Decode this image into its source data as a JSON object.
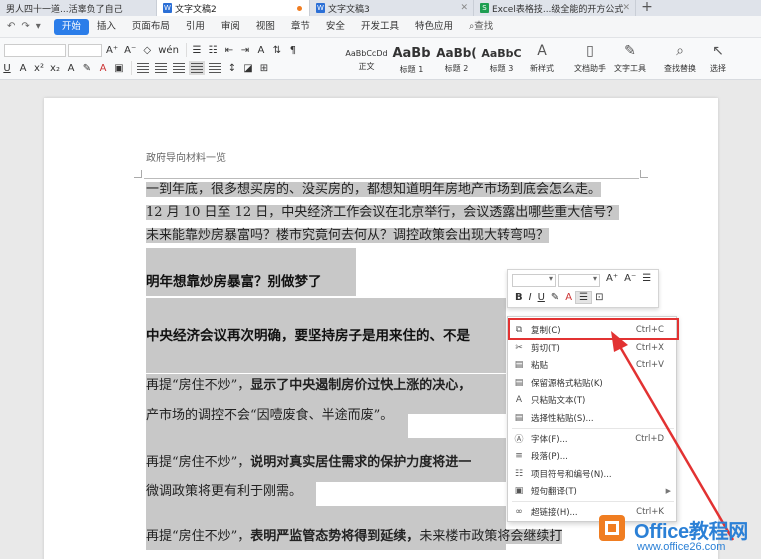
{
  "tabs": [
    {
      "label": "男人四十一道...活辜负了自己",
      "active": false
    },
    {
      "label": "文字文稿2",
      "active": true
    },
    {
      "label": "文字文稿3",
      "active": false
    },
    {
      "label": "Excel表格技...级全能的开方公式",
      "active": false
    }
  ],
  "tab_add": "+",
  "menu": {
    "start": "开始",
    "items": [
      "插入",
      "页面布局",
      "引用",
      "审阅",
      "视图",
      "章节",
      "安全",
      "开发工具",
      "特色应用"
    ],
    "search": "查找"
  },
  "ribbon": {
    "styles": [
      {
        "sample": "AaBbCcDd",
        "name": "正文"
      },
      {
        "sample": "AaBb",
        "name": "标题 1"
      },
      {
        "sample": "AaBb(",
        "name": "标题 2"
      },
      {
        "sample": "AaBbC",
        "name": "标题 3"
      }
    ],
    "big_buttons": [
      {
        "icon": "new-style-icon",
        "label": "新样式"
      },
      {
        "icon": "doc-helper-icon",
        "label": "文档助手"
      },
      {
        "icon": "text-tools-icon",
        "label": "文字工具"
      },
      {
        "icon": "find-replace-icon",
        "label": "查找替换"
      },
      {
        "icon": "select-icon",
        "label": "选择"
      }
    ]
  },
  "document": {
    "header_text": "政府导向材料一览",
    "para1": [
      "一到年底，很多想买房的、没买房的，都想知道明年房地产市场到底会怎么走。",
      "12 月 10 日至 12 日，中央经济工作会议在北京举行，会议透露出哪些重大信号？",
      "未来能靠炒房暴富吗？楼市究竟何去何从？调控政策会出现大转弯吗？"
    ],
    "heading1": "明年想靠炒房暴富？别做梦了",
    "heading2": "中央经济会议再次明确，要坚持房子是用来住的、不是",
    "p3a_prefix": "再提“房住不炒”，",
    "p3a_bold": "显示了中央遏制房价过快上涨的决心，",
    "p3b": "产市场的调控不会“因噎废食、半途而废”。",
    "p4a_prefix": "再提“房住不炒”，",
    "p4a_bold": "说明对真实居住需求的保护力度将进一",
    "p4b": "微调政策将更有利于刚需。",
    "p5a_prefix": "再提“房住不炒”，",
    "p5a_bold": "表明严监管态势将得到延续，",
    "p5a_tail": "未来楼市政策将会继续打"
  },
  "mini_toolbar": {
    "bold": "B",
    "italic": "I",
    "underline": "U",
    "font_grow": "A⁺",
    "font_shrink": "A⁻"
  },
  "context_menu": [
    {
      "icon": "copy-icon",
      "label": "复制(C)",
      "shortcut": "Ctrl+C"
    },
    {
      "icon": "cut-icon",
      "label": "剪切(T)",
      "shortcut": "Ctrl+X"
    },
    {
      "icon": "paste-icon",
      "label": "粘贴",
      "shortcut": "Ctrl+V"
    },
    {
      "icon": "paste-keep-format-icon",
      "label": "保留源格式粘贴(K)",
      "shortcut": ""
    },
    {
      "icon": "paste-text-icon",
      "label": "只粘贴文本(T)",
      "shortcut": ""
    },
    {
      "icon": "paste-special-icon",
      "label": "选择性粘贴(S)...",
      "shortcut": ""
    },
    {
      "icon": "font-icon",
      "label": "字体(F)...",
      "shortcut": "Ctrl+D"
    },
    {
      "icon": "paragraph-icon",
      "label": "段落(P)...",
      "shortcut": ""
    },
    {
      "icon": "bullets-icon",
      "label": "项目符号和编号(N)...",
      "shortcut": ""
    },
    {
      "icon": "translate-icon",
      "label": "短句翻译(T)",
      "shortcut": ""
    },
    {
      "icon": "hyperlink-icon",
      "label": "超链接(H)...",
      "shortcut": "Ctrl+K"
    }
  ],
  "watermark": {
    "brand": "Office教程网",
    "site": "www.office26.com"
  },
  "colors": {
    "accent": "#2b7de9",
    "highlight_border": "#e23232",
    "selection": "#c8c8c8"
  }
}
